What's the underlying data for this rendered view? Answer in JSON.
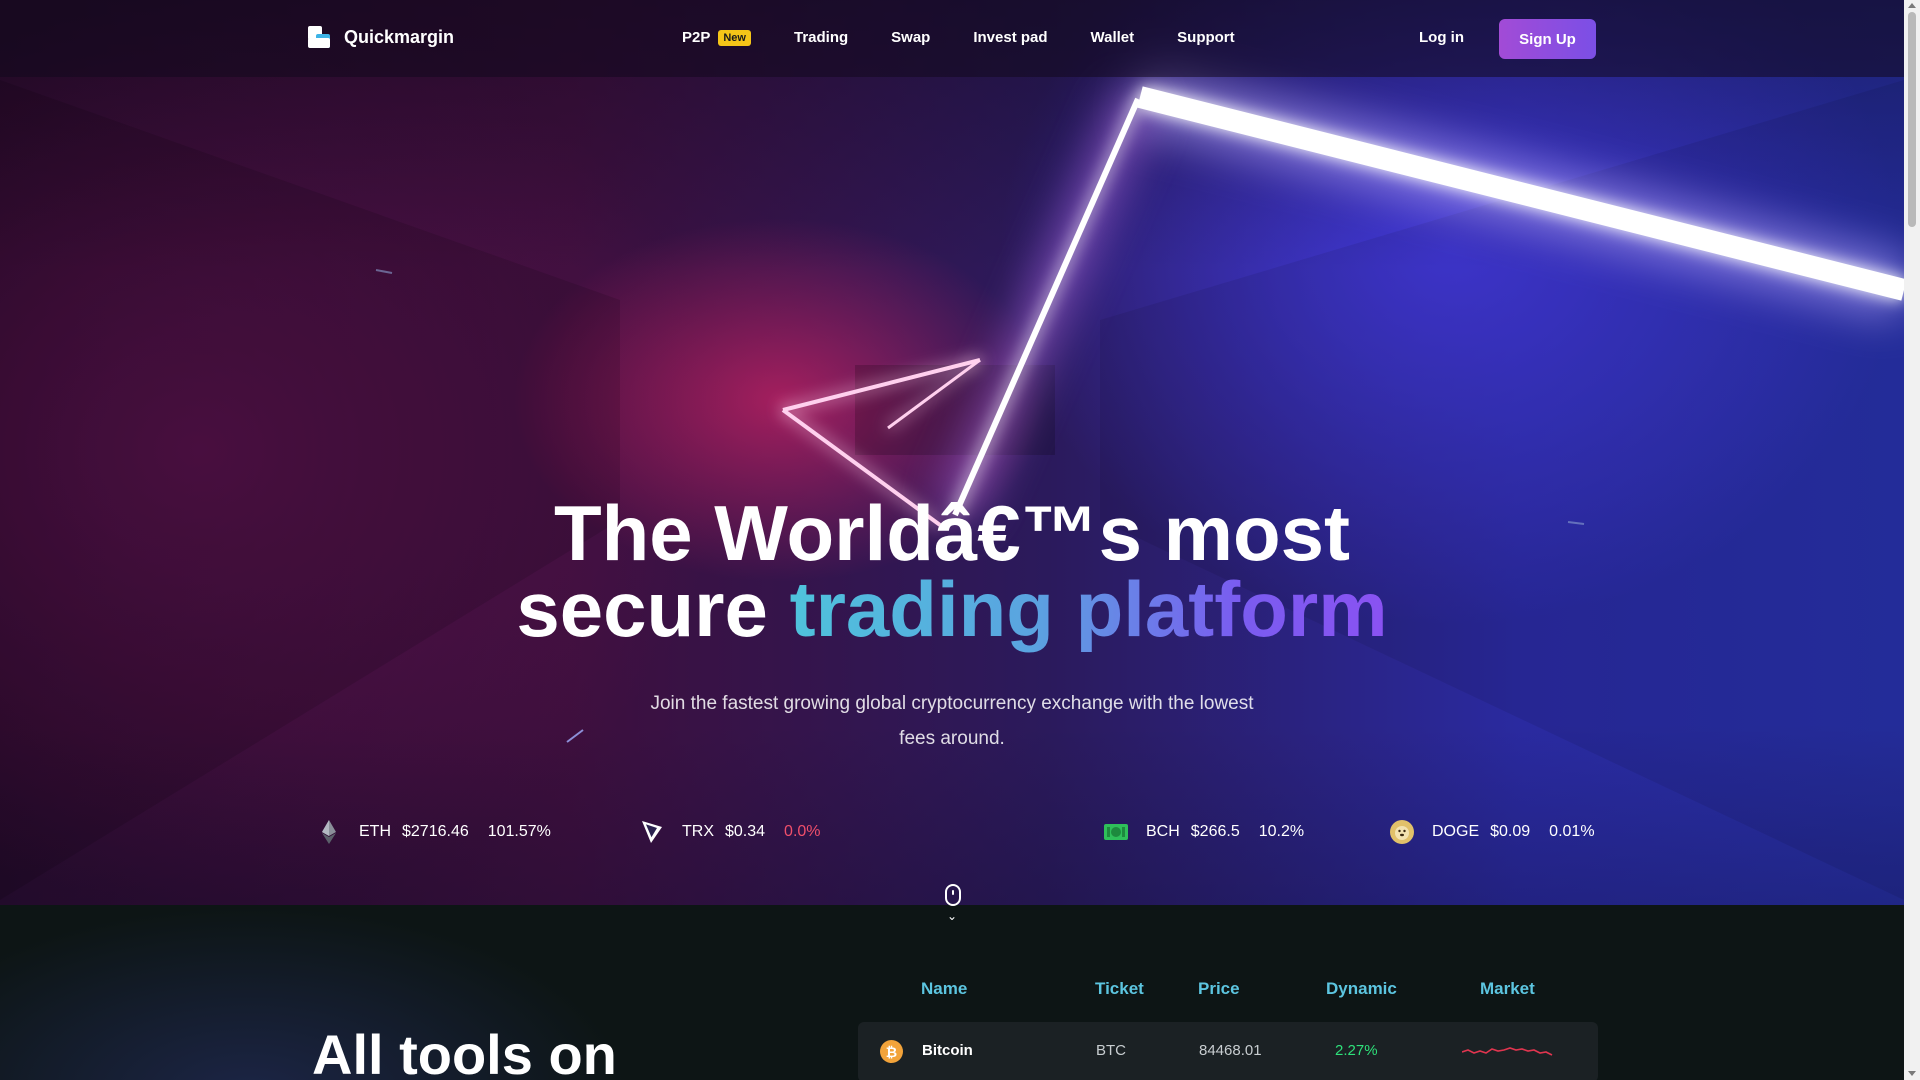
{
  "brand": {
    "name": "Quickmargin"
  },
  "nav": {
    "items": [
      {
        "label": "P2P",
        "badge": "New"
      },
      {
        "label": "Trading"
      },
      {
        "label": "Swap"
      },
      {
        "label": "Invest pad"
      },
      {
        "label": "Wallet"
      },
      {
        "label": "Support"
      }
    ],
    "login_label": "Log in",
    "signup_label": "Sign Up"
  },
  "hero": {
    "headline_line1": "The Worldâ€™s most",
    "headline_line2_plain": "secure ",
    "headline_line2_gradient": "trading platform",
    "subtitle_line1": "Join the fastest growing global cryptocurrency exchange with the lowest",
    "subtitle_line2": "fees around."
  },
  "ticker": [
    {
      "symbol": "ETH",
      "price": "$2716.46",
      "change": "101.57%",
      "icon": "ethereum-icon"
    },
    {
      "symbol": "TRX",
      "price": "$0.34",
      "change": "0.0%",
      "icon": "tron-icon"
    },
    {
      "symbol": "BCH",
      "price": "$266.5",
      "change": "10.2%",
      "icon": "bitcoin-cash-icon"
    },
    {
      "symbol": "DOGE",
      "price": "$0.09",
      "change": "0.01%",
      "icon": "dogecoin-icon"
    }
  ],
  "tools": {
    "title": "All tools on"
  },
  "market_table": {
    "headers": [
      "Name",
      "Ticket",
      "Price",
      "Dynamic",
      "Market"
    ],
    "rows": [
      {
        "name": "Bitcoin",
        "ticket": "BTC",
        "price": "84468.01",
        "dynamic": "2.27%",
        "icon": "bitcoin-icon"
      }
    ]
  },
  "colors": {
    "accent_cyan": "#5cc5e0",
    "accent_purple": "#8a52f2",
    "signup_gradient_start": "#a24bd6",
    "badge_yellow": "#f5c518",
    "positive_green": "#2ee07a",
    "negative_red": "#f04f6b"
  }
}
